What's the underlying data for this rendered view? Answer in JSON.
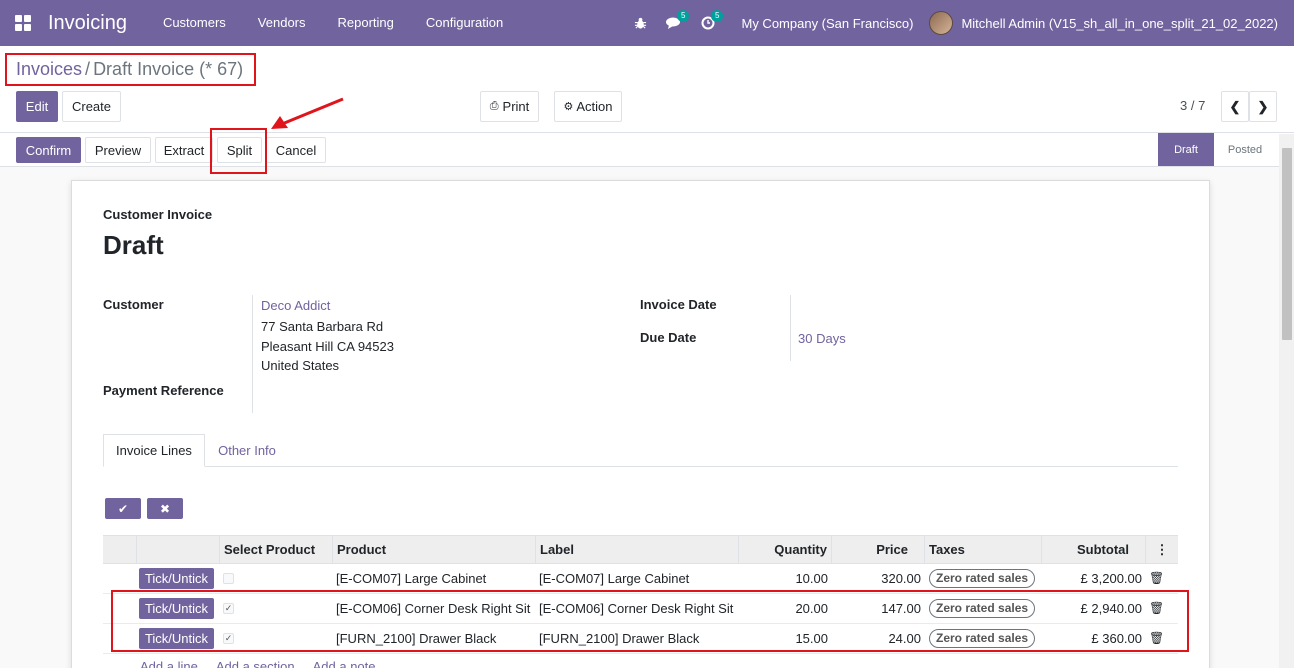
{
  "navbar": {
    "app_name": "Invoicing",
    "menu": [
      "Customers",
      "Vendors",
      "Reporting",
      "Configuration"
    ],
    "icons": {
      "apps": "apps-grid-icon",
      "debug": "bug-icon",
      "messages": "chat-icon",
      "activities": "clock-icon"
    },
    "messages_count": "5",
    "activities_count": "5",
    "company": "My Company (San Francisco)",
    "user": "Mitchell Admin (V15_sh_all_in_one_split_21_02_2022)"
  },
  "breadcrumb": {
    "parent": "Invoices",
    "separator": "/",
    "current": "Draft Invoice (* 67)"
  },
  "toolbar": {
    "edit": "Edit",
    "create": "Create",
    "print": "Print",
    "action": "Action",
    "pager": "3 / 7"
  },
  "statusbar": {
    "buttons": [
      "Confirm",
      "Preview",
      "Extract",
      "Split",
      "Cancel"
    ],
    "stages": [
      "Draft",
      "Posted"
    ],
    "active_stage": "Draft"
  },
  "sheet": {
    "type_label": "Customer Invoice",
    "title": "Draft",
    "customer_label": "Customer",
    "customer_name": "Deco Addict",
    "address": [
      "77 Santa Barbara Rd",
      "Pleasant Hill CA 94523",
      "United States"
    ],
    "payment_reference_label": "Payment Reference",
    "invoice_date_label": "Invoice Date",
    "due_date_label": "Due Date",
    "due_date_value": "30 Days"
  },
  "tabs": [
    "Invoice Lines",
    "Other Info"
  ],
  "table": {
    "headers": [
      "Select Product",
      "Product",
      "Label",
      "Quantity",
      "Price",
      "Taxes",
      "Subtotal"
    ],
    "tick_label": "Tick/Untick",
    "rows": [
      {
        "checked": false,
        "product": "[E-COM07] Large Cabinet",
        "label": "[E-COM07] Large Cabinet",
        "quantity": "10.00",
        "price": "320.00",
        "tax": "Zero rated sales",
        "subtotal": "£ 3,200.00"
      },
      {
        "checked": true,
        "product": "[E-COM06] Corner Desk Right Sit",
        "label": "[E-COM06] Corner Desk Right Sit",
        "quantity": "20.00",
        "price": "147.00",
        "tax": "Zero rated sales",
        "subtotal": "£ 2,940.00"
      },
      {
        "checked": true,
        "product": "[FURN_2100] Drawer Black",
        "label": "[FURN_2100] Drawer Black",
        "quantity": "15.00",
        "price": "24.00",
        "tax": "Zero rated sales",
        "subtotal": "£ 360.00"
      }
    ],
    "add_links": [
      "Add a line",
      "Add a section",
      "Add a note"
    ]
  },
  "colors": {
    "primary": "#71639e",
    "annotation_red": "#e0141b"
  }
}
